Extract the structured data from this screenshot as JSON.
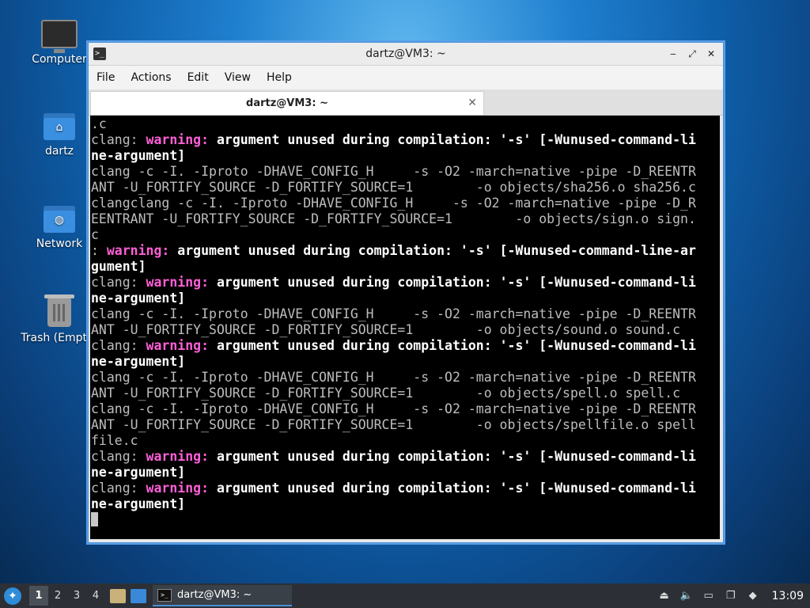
{
  "desktop": {
    "icons": [
      {
        "label": "Computer",
        "icon": "computer-icon"
      },
      {
        "label": "dartz",
        "icon": "home-folder-icon"
      },
      {
        "label": "Network",
        "icon": "network-folder-icon"
      },
      {
        "label": "Trash (Empty)",
        "icon": "trash-icon"
      }
    ]
  },
  "window": {
    "title": "dartz@VM3: ~",
    "controls": {
      "minimize": "‒",
      "maximize": "⤢",
      "close": "✕"
    },
    "menu": [
      "File",
      "Actions",
      "Edit",
      "View",
      "Help"
    ],
    "tab": {
      "title": "dartz@VM3: ~",
      "close": "✕"
    }
  },
  "terminal": {
    "lines": [
      [
        {
          "t": ".c",
          "s": "n"
        }
      ],
      [
        {
          "t": "clang: ",
          "s": "n"
        },
        {
          "t": "warning: ",
          "s": "w"
        },
        {
          "t": "argument unused during compilation: '-s' [-Wunused-command-li",
          "s": "b"
        }
      ],
      [
        {
          "t": "ne-argument]",
          "s": "b"
        }
      ],
      [
        {
          "t": "clang -c -I. -Iproto -DHAVE_CONFIG_H     -s -O2 -march=native -pipe -D_REENTR",
          "s": "n"
        }
      ],
      [
        {
          "t": "ANT -U_FORTIFY_SOURCE -D_FORTIFY_SOURCE=1        -o objects/sha256.o sha256.c",
          "s": "n"
        }
      ],
      [
        {
          "t": "clangclang -c -I. -Iproto -DHAVE_CONFIG_H     -s -O2 -march=native -pipe -D_R",
          "s": "n"
        }
      ],
      [
        {
          "t": "EENTRANT -U_FORTIFY_SOURCE -D_FORTIFY_SOURCE=1        -o objects/sign.o sign.",
          "s": "n"
        }
      ],
      [
        {
          "t": "c",
          "s": "n"
        }
      ],
      [
        {
          "t": ": ",
          "s": "n"
        },
        {
          "t": "warning: ",
          "s": "w"
        },
        {
          "t": "argument unused during compilation: '-s' [-Wunused-command-line-ar",
          "s": "b"
        }
      ],
      [
        {
          "t": "gument]",
          "s": "b"
        }
      ],
      [
        {
          "t": "clang: ",
          "s": "n"
        },
        {
          "t": "warning: ",
          "s": "w"
        },
        {
          "t": "argument unused during compilation: '-s' [-Wunused-command-li",
          "s": "b"
        }
      ],
      [
        {
          "t": "ne-argument]",
          "s": "b"
        }
      ],
      [
        {
          "t": "clang -c -I. -Iproto -DHAVE_CONFIG_H     -s -O2 -march=native -pipe -D_REENTR",
          "s": "n"
        }
      ],
      [
        {
          "t": "ANT -U_FORTIFY_SOURCE -D_FORTIFY_SOURCE=1        -o objects/sound.o sound.c",
          "s": "n"
        }
      ],
      [
        {
          "t": "clang: ",
          "s": "n"
        },
        {
          "t": "warning: ",
          "s": "w"
        },
        {
          "t": "argument unused during compilation: '-s' [-Wunused-command-li",
          "s": "b"
        }
      ],
      [
        {
          "t": "ne-argument]",
          "s": "b"
        }
      ],
      [
        {
          "t": "clang -c -I. -Iproto -DHAVE_CONFIG_H     -s -O2 -march=native -pipe -D_REENTR",
          "s": "n"
        }
      ],
      [
        {
          "t": "ANT -U_FORTIFY_SOURCE -D_FORTIFY_SOURCE=1        -o objects/spell.o spell.c",
          "s": "n"
        }
      ],
      [
        {
          "t": "clang -c -I. -Iproto -DHAVE_CONFIG_H     -s -O2 -march=native -pipe -D_REENTR",
          "s": "n"
        }
      ],
      [
        {
          "t": "ANT -U_FORTIFY_SOURCE -D_FORTIFY_SOURCE=1        -o objects/spellfile.o spell",
          "s": "n"
        }
      ],
      [
        {
          "t": "file.c",
          "s": "n"
        }
      ],
      [
        {
          "t": "clang: ",
          "s": "n"
        },
        {
          "t": "warning: ",
          "s": "w"
        },
        {
          "t": "argument unused during compilation: '-s' [-Wunused-command-li",
          "s": "b"
        }
      ],
      [
        {
          "t": "ne-argument]",
          "s": "b"
        }
      ],
      [
        {
          "t": "clang: ",
          "s": "n"
        },
        {
          "t": "warning: ",
          "s": "w"
        },
        {
          "t": "argument unused during compilation: '-s' [-Wunused-command-li",
          "s": "b"
        }
      ],
      [
        {
          "t": "ne-argument]",
          "s": "b"
        }
      ]
    ],
    "colors": {
      "background": "#000000",
      "text": "#bdbdbd",
      "warning": "#ff5fd7",
      "bold": "#ffffff"
    }
  },
  "taskbar": {
    "workspaces": [
      "1",
      "2",
      "3",
      "4"
    ],
    "active_workspace": "1",
    "task": {
      "label": "dartz@VM3: ~"
    },
    "clock": "13:09"
  }
}
